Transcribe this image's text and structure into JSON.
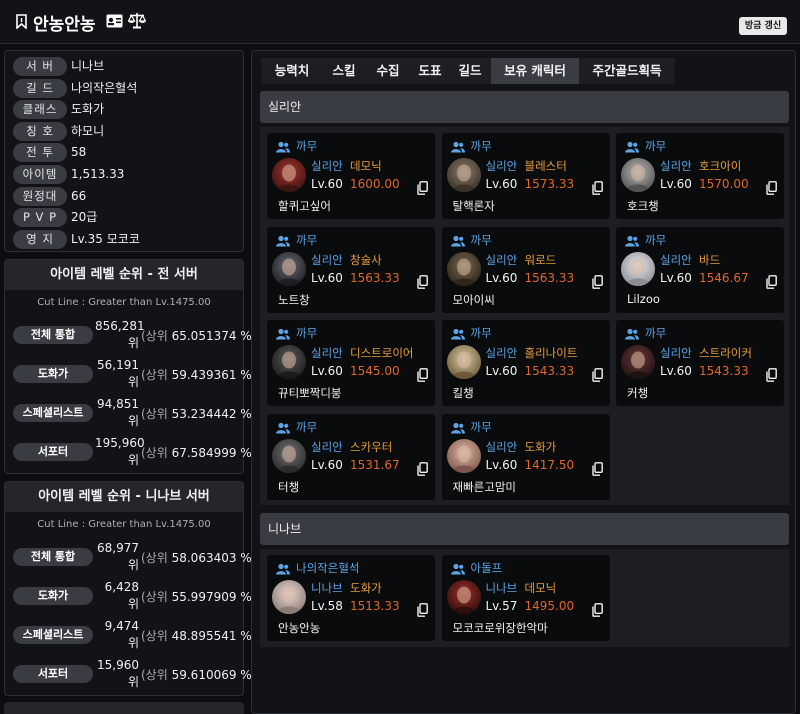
{
  "header": {
    "title": "안농안농",
    "refresh_label": "방금 갱신"
  },
  "info": [
    {
      "label": "서 버",
      "value": "니나브"
    },
    {
      "label": "길 드",
      "value": "나의작은혈석"
    },
    {
      "label": "클래스",
      "value": "도화가"
    },
    {
      "label": "칭 호",
      "value": "하모니"
    },
    {
      "label": "전 투",
      "value": "58"
    },
    {
      "label": "아이템",
      "value": "1,513.33"
    },
    {
      "label": "원정대",
      "value": "66"
    },
    {
      "label": "P V P",
      "value": "20급"
    },
    {
      "label": "영 지",
      "value": "Lv.35 모코코"
    }
  ],
  "rankings": [
    {
      "title": "아이템 레벨 순위 - 전 서버",
      "cutline": "Cut Line : Greater than Lv.1475.00",
      "rows": [
        {
          "label": "전체 통합",
          "rank": "856,281",
          "unit": "위",
          "prefix": "(상위",
          "pct": "65.051374 %)"
        },
        {
          "label": "도화가",
          "rank": "56,191",
          "unit": "위",
          "prefix": "(상위",
          "pct": "59.439361 %)"
        },
        {
          "label": "스페셜리스트",
          "rank": "94,851",
          "unit": "위",
          "prefix": "(상위",
          "pct": "53.234442 %)"
        },
        {
          "label": "서포터",
          "rank": "195,960",
          "unit": "위",
          "prefix": "(상위",
          "pct": "67.584999 %)"
        }
      ]
    },
    {
      "title": "아이템 레벨 순위 - 니나브 서버",
      "cutline": "Cut Line : Greater than Lv.1475.00",
      "rows": [
        {
          "label": "전체 통합",
          "rank": "68,977",
          "unit": "위",
          "prefix": "(상위",
          "pct": "58.063403 %)"
        },
        {
          "label": "도화가",
          "rank": "6,428",
          "unit": "위",
          "prefix": "(상위",
          "pct": "55.997909 %)"
        },
        {
          "label": "스페셜리스트",
          "rank": "9,474",
          "unit": "위",
          "prefix": "(상위",
          "pct": "48.895541 %)"
        },
        {
          "label": "서포터",
          "rank": "15,960",
          "unit": "위",
          "prefix": "(상위",
          "pct": "59.610069 %)"
        }
      ]
    }
  ],
  "tabs": [
    "능력치",
    "스킬",
    "수집",
    "도표",
    "길드",
    "보유 캐릭터",
    "주간골드획득"
  ],
  "active_tab": "보유 캐릭터",
  "server_groups": [
    {
      "server": "실리안",
      "characters": [
        {
          "guild": "까무",
          "server": "실리안",
          "class": "데모닉",
          "level": "Lv.60",
          "item_level": "1600.00",
          "name": "할퀴고싶어"
        },
        {
          "guild": "까무",
          "server": "실리안",
          "class": "블레스터",
          "level": "Lv.60",
          "item_level": "1573.33",
          "name": "탈핵론자"
        },
        {
          "guild": "까무",
          "server": "실리안",
          "class": "호크아이",
          "level": "Lv.60",
          "item_level": "1570.00",
          "name": "호크챙"
        },
        {
          "guild": "까무",
          "server": "실리안",
          "class": "창술사",
          "level": "Lv.60",
          "item_level": "1563.33",
          "name": "노트창"
        },
        {
          "guild": "까무",
          "server": "실리안",
          "class": "워로드",
          "level": "Lv.60",
          "item_level": "1563.33",
          "name": "모아이씨"
        },
        {
          "guild": "까무",
          "server": "실리안",
          "class": "바드",
          "level": "Lv.60",
          "item_level": "1546.67",
          "name": "Lilzoo"
        },
        {
          "guild": "까무",
          "server": "실리안",
          "class": "디스트로이어",
          "level": "Lv.60",
          "item_level": "1545.00",
          "name": "뀨티뽀짝디붕"
        },
        {
          "guild": "까무",
          "server": "실리안",
          "class": "홀리나이트",
          "level": "Lv.60",
          "item_level": "1543.33",
          "name": "킬챙"
        },
        {
          "guild": "까무",
          "server": "실리안",
          "class": "스트라이커",
          "level": "Lv.60",
          "item_level": "1543.33",
          "name": "커챙"
        },
        {
          "guild": "까무",
          "server": "실리안",
          "class": "스카우터",
          "level": "Lv.60",
          "item_level": "1531.67",
          "name": "터챙"
        },
        {
          "guild": "까무",
          "server": "실리안",
          "class": "도화가",
          "level": "Lv.60",
          "item_level": "1417.50",
          "name": "재빠른고맘미"
        }
      ]
    },
    {
      "server": "니나브",
      "characters": [
        {
          "guild": "나의작은혈석",
          "server": "니나브",
          "class": "도화가",
          "level": "Lv.58",
          "item_level": "1513.33",
          "name": "안농안농"
        },
        {
          "guild": "아돌프",
          "server": "니나브",
          "class": "데모닉",
          "level": "Lv.57",
          "item_level": "1495.00",
          "name": "모코코로위장한악마"
        }
      ]
    }
  ],
  "colors": {
    "accent_blue": "#5da3e6",
    "class_orange": "#e79d3d",
    "item_level_orange": "#e0662a",
    "panel_bg": "#121317",
    "label_pill": "#3a3c43"
  },
  "avatar_tones": [
    [
      "#a8322c",
      "#3a1410"
    ],
    [
      "#8a7a6a",
      "#3a3028"
    ],
    [
      "#b8b8b8",
      "#505050"
    ],
    [
      "#6a6a72",
      "#1c1c22"
    ],
    [
      "#7a6a52",
      "#2e2418"
    ],
    [
      "#e8e8ec",
      "#8a8a92"
    ],
    [
      "#5c5c5c",
      "#1a1a1a"
    ],
    [
      "#d8c8a0",
      "#6a5838"
    ],
    [
      "#6a3a38",
      "#1e1010"
    ],
    [
      "#707070",
      "#2a2a2a"
    ],
    [
      "#e0b8a8",
      "#7a5448"
    ],
    [
      "#e8d8d0",
      "#8a7a74"
    ],
    [
      "#a03028",
      "#2c0e0c"
    ]
  ]
}
